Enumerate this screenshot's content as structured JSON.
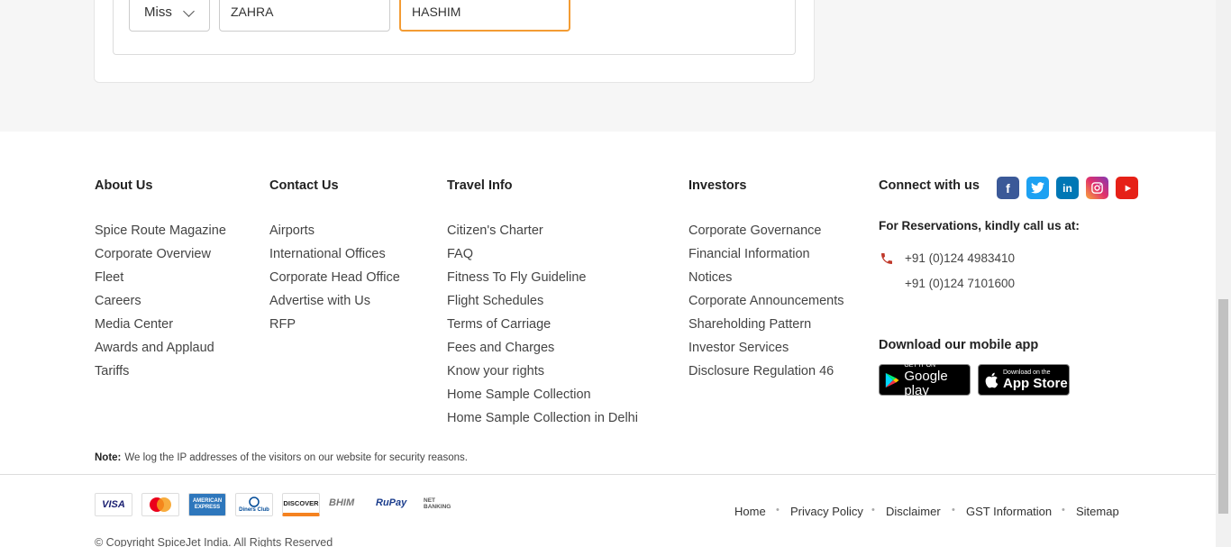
{
  "form": {
    "title_value": "Miss",
    "first_name": "ZAHRA",
    "last_name": "HASHIM"
  },
  "footer": {
    "about": {
      "heading": "About Us",
      "items": [
        "Spice Route Magazine",
        "Corporate Overview",
        "Fleet",
        "Careers",
        "Media Center",
        "Awards and Applaud",
        "Tariffs"
      ]
    },
    "contact": {
      "heading": "Contact Us",
      "items": [
        "Airports",
        "International Offices",
        "Corporate Head Office",
        "Advertise with Us",
        "RFP"
      ]
    },
    "travel": {
      "heading": "Travel Info",
      "items": [
        "Citizen's Charter",
        "FAQ",
        "Fitness To Fly Guideline",
        "Flight Schedules",
        "Terms of Carriage",
        "Fees and Charges",
        "Know your rights",
        "Home Sample Collection",
        "Home Sample Collection in Delhi"
      ]
    },
    "investors": {
      "heading": "Investors",
      "items": [
        "Corporate Governance",
        "Financial Information",
        "Notices",
        "Corporate Announcements",
        "Shareholding Pattern",
        "Investor Services",
        "Disclosure Regulation 46"
      ]
    },
    "connect": {
      "heading": "Connect with us",
      "social_icons": [
        "facebook-icon",
        "twitter-icon",
        "linkedin-icon",
        "instagram-icon",
        "youtube-icon"
      ],
      "social_colors": [
        "#3b5998",
        "#1da1f2",
        "#0077b5",
        "#c13584",
        "#e62117"
      ],
      "reservations": "For Reservations, kindly call us at:",
      "phone1": "+91 (0)124 4983410",
      "phone2": "+91 (0)124 7101600",
      "download_title": "Download our mobile app",
      "google_small": "GET IT ON",
      "google_big": "Google play",
      "apple_small": "Download on the",
      "apple_big": "App Store"
    },
    "note_label": "Note:",
    "note_text": "We log the IP addresses of the visitors on our website for security reasons.",
    "payments": [
      "VISA",
      "MasterCard",
      "AMERICAN EXPRESS",
      "Diners Club",
      "DISCOVER",
      "BHIM",
      "RuPay",
      "NET BANKING"
    ],
    "bottom_links": [
      "Home",
      "Privacy Policy",
      "Disclaimer",
      "GST Information",
      "Sitemap"
    ],
    "copyright": "© Copyright SpiceJet India. All Rights Reserved"
  }
}
